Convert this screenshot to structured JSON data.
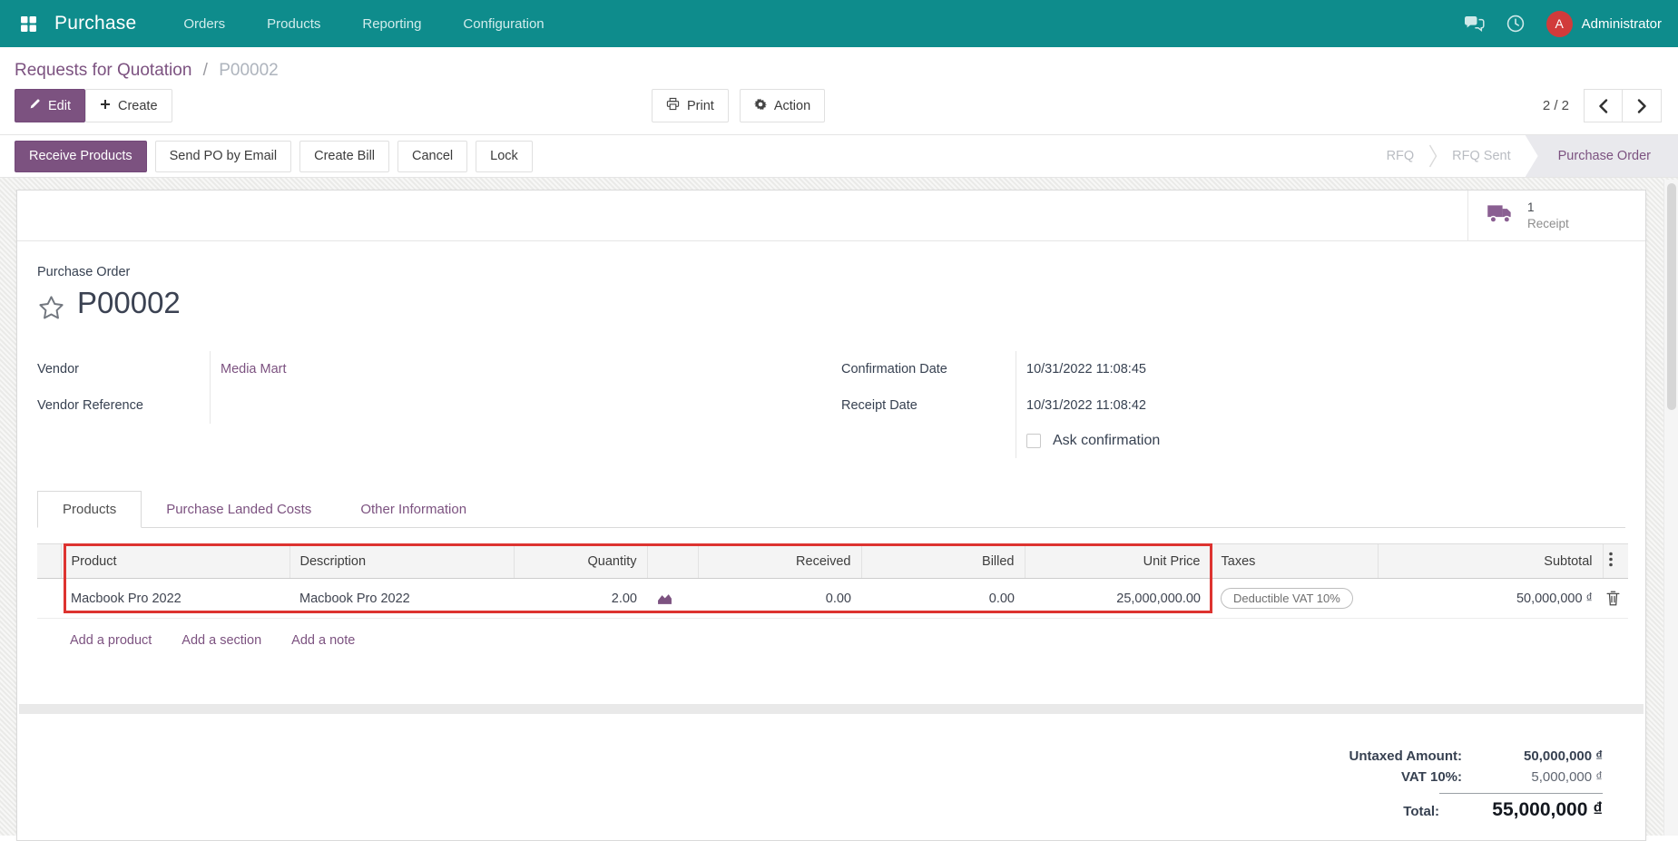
{
  "nav": {
    "app_name": "Purchase",
    "menus": [
      {
        "label": "Orders"
      },
      {
        "label": "Products"
      },
      {
        "label": "Reporting"
      },
      {
        "label": "Configuration"
      }
    ],
    "user": {
      "name": "Administrator",
      "avatar_initial": "A"
    }
  },
  "breadcrumb": {
    "parent": "Requests for Quotation",
    "separator": "/",
    "current": "P00002"
  },
  "control_panel": {
    "edit_label": "Edit",
    "create_label": "Create",
    "print_label": "Print",
    "action_label": "Action",
    "pager": {
      "text": "2 / 2"
    }
  },
  "statusbar": {
    "buttons": [
      {
        "label": "Receive Products",
        "primary": true
      },
      {
        "label": "Send PO by Email"
      },
      {
        "label": "Create Bill"
      },
      {
        "label": "Cancel"
      },
      {
        "label": "Lock"
      }
    ],
    "steps": [
      {
        "label": "RFQ",
        "state": "inactive"
      },
      {
        "label": "RFQ Sent",
        "state": "inactive"
      },
      {
        "label": "Purchase Order",
        "state": "current"
      }
    ]
  },
  "button_box": {
    "receipt_count": "1",
    "receipt_label": "Receipt"
  },
  "order": {
    "type_label": "Purchase Order",
    "name": "P00002",
    "fields_left": [
      {
        "label": "Vendor",
        "value": "Media Mart",
        "is_link": true
      },
      {
        "label": "Vendor Reference",
        "value": ""
      }
    ],
    "fields_right": [
      {
        "label": "Confirmation Date",
        "value": "10/31/2022 11:08:45"
      },
      {
        "label": "Receipt Date",
        "value": "10/31/2022 11:08:42"
      }
    ],
    "ask_confirmation_label": "Ask confirmation",
    "ask_confirmation_checked": false
  },
  "tabs": [
    {
      "label": "Products",
      "active": true
    },
    {
      "label": "Purchase Landed Costs",
      "active": false
    },
    {
      "label": "Other Information",
      "active": false
    }
  ],
  "lines_table": {
    "headers": [
      "Product",
      "Description",
      "Quantity",
      "Received",
      "Billed",
      "Unit Price",
      "Taxes",
      "Subtotal"
    ],
    "rows": [
      {
        "product": "Macbook Pro 2022",
        "description": "Macbook Pro 2022",
        "quantity": "2.00",
        "received": "0.00",
        "billed": "0.00",
        "unit_price": "25,000,000.00",
        "taxes": "Deductible VAT 10%",
        "subtotal": "50,000,000 ₫"
      }
    ],
    "footer_links": [
      "Add a product",
      "Add a section",
      "Add a note"
    ]
  },
  "totals": {
    "rows": [
      {
        "label": "Untaxed Amount:",
        "value": "50,000,000 ₫"
      },
      {
        "label": "VAT 10%:",
        "value": "5,000,000 ₫"
      }
    ],
    "total_label": "Total:",
    "total_value": "55,000,000 ₫"
  },
  "colors": {
    "navbar": "#0e8c8c",
    "primary": "#7c5280",
    "avatar": "#d13b3b",
    "annotation_red": "#dd3330",
    "step_current_bg": "#e9e9ed"
  },
  "icons": {
    "apps-grid-icon": "2x2-squares",
    "chat-icon": "speech-bubbles",
    "activity-clock-icon": "clock",
    "edit-pencil-icon": "pencil",
    "create-plus-icon": "+",
    "print-icon": "printer",
    "action-gear-icon": "gear",
    "pager-prev-icon": "chevron-left",
    "pager-next-icon": "chevron-right",
    "receipt-truck-icon": "truck",
    "favorite-star-icon": "star-outline",
    "forecast-chart-icon": "area-chart",
    "delete-trash-icon": "trash-can",
    "optional-columns-icon": "kebab-dots"
  }
}
